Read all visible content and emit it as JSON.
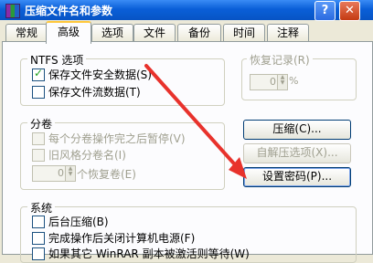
{
  "window": {
    "title": "压缩文件名和参数",
    "help_glyph": "?",
    "close_glyph": "✕"
  },
  "tabs": [
    {
      "label": "常规"
    },
    {
      "label": "高级"
    },
    {
      "label": "选项"
    },
    {
      "label": "文件"
    },
    {
      "label": "备份"
    },
    {
      "label": "时间"
    },
    {
      "label": "注释"
    }
  ],
  "active_tab": "高级",
  "ntfs": {
    "title": "NTFS 选项",
    "save_security": {
      "label": "保存文件安全数据(S)",
      "checked": true
    },
    "save_streams": {
      "label": "保存文件流数据(T)",
      "checked": false
    }
  },
  "recovery": {
    "title": "恢复记录(R)",
    "value": "0",
    "unit": "%"
  },
  "volumes": {
    "title": "分卷",
    "pause_each": {
      "label": "每个分卷操作完之后暂停(V)",
      "checked": false
    },
    "old_style": {
      "label": "旧风格分卷名(I)",
      "checked": false
    },
    "count_value": "0",
    "count_label": "个恢复卷(E)"
  },
  "buttons": {
    "compression": "压缩(C)...",
    "sfx": "自解压选项(X)...",
    "set_password": "设置密码(P)..."
  },
  "system": {
    "title": "系统",
    "background": {
      "label": "后台压缩(B)",
      "checked": false
    },
    "shutdown": {
      "label": "完成操作后关闭计算机电源(F)",
      "checked": false
    },
    "third": {
      "label": "如果其它 WinRAR 副本被激活则等待(W)",
      "checked": false
    }
  },
  "annotation_color": "#e8322c"
}
